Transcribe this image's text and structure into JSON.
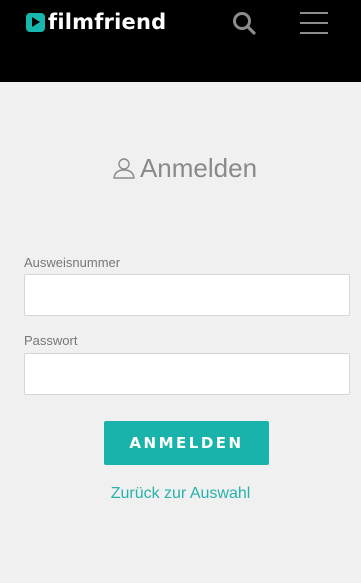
{
  "header": {
    "brand": "filmfriend",
    "colors": {
      "background": "#000000",
      "accent": "#17b7ad",
      "icon": "#8c8c8c"
    },
    "icons": {
      "logo": "play-logo-icon",
      "search": "search-icon",
      "menu": "hamburger-menu-icon"
    }
  },
  "login": {
    "title": "Anmelden",
    "title_icon": "user-icon",
    "id_label": "Ausweisnummer",
    "id_value": "",
    "password_label": "Passwort",
    "password_value": "",
    "submit_label": "ANMELDEN",
    "back_link": "Zurück zur Auswahl",
    "colors": {
      "page_background": "#f0f0f0",
      "button": "#19b3ab",
      "link": "#27b2ab"
    }
  }
}
